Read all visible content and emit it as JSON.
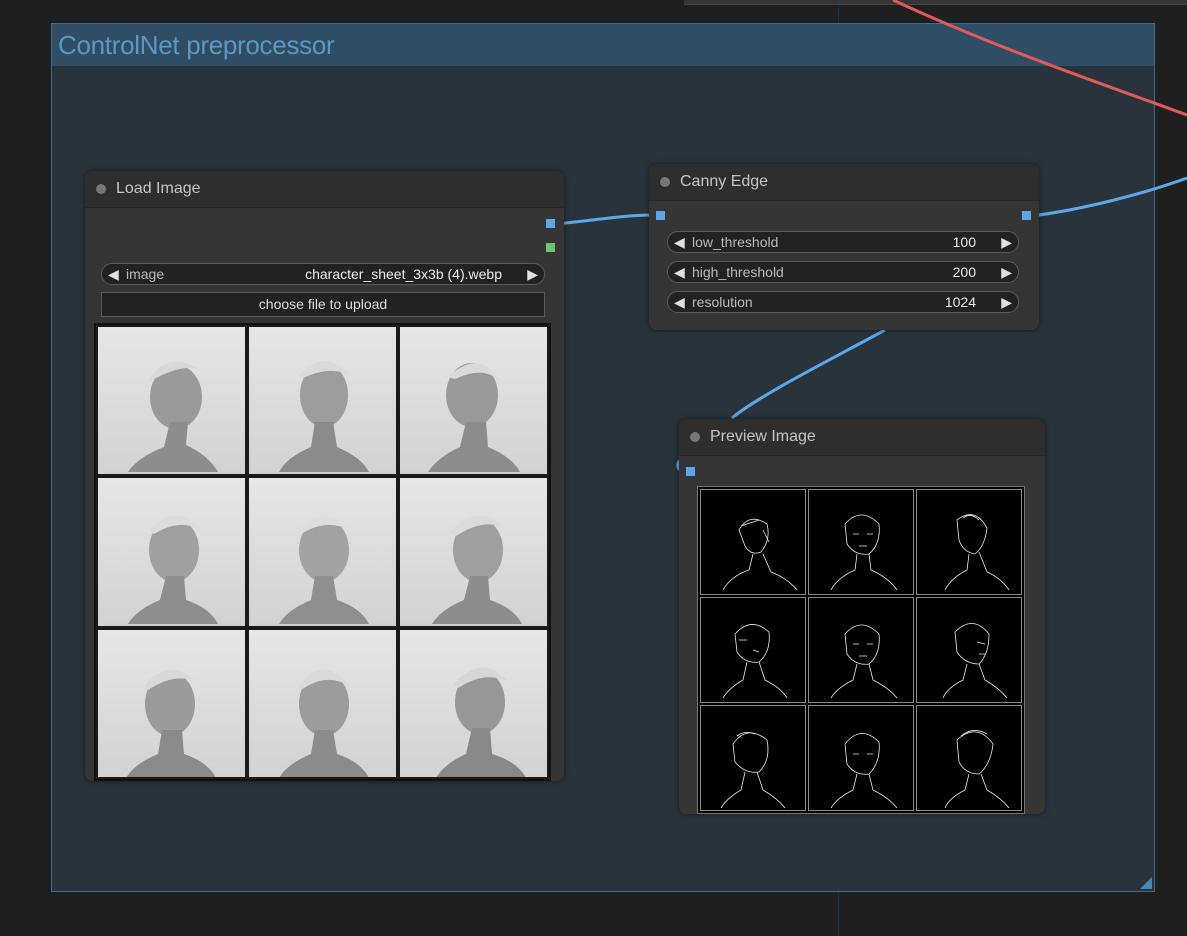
{
  "group": {
    "title": "ControlNet preprocessor"
  },
  "load_image": {
    "title": "Load Image",
    "image_widget": {
      "label": "image",
      "value": "character_sheet_3x3b (4).webp"
    },
    "upload_label": "choose file to upload"
  },
  "canny": {
    "title": "Canny Edge",
    "widgets": [
      {
        "label": "low_threshold",
        "value": "100"
      },
      {
        "label": "high_threshold",
        "value": "200"
      },
      {
        "label": "resolution",
        "value": "1024"
      }
    ]
  },
  "preview": {
    "title": "Preview Image"
  },
  "colors": {
    "wire_image": "#5ba7e8",
    "wire_red": "#e05a5a",
    "group_border": "#3b6c8e",
    "group_title": "#5d97c0"
  },
  "icons": {
    "arrow_left": "◀",
    "arrow_right": "▶"
  }
}
